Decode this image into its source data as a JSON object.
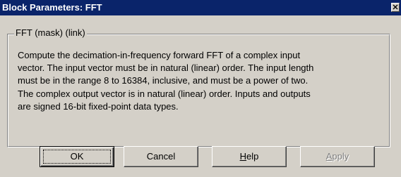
{
  "window": {
    "title": "Block Parameters: FFT"
  },
  "group": {
    "legend": "FFT (mask) (link)",
    "description_lines": [
      "Compute the decimation-in-frequency forward FFT of a complex input",
      "vector. The input vector must be in natural (linear) order. The input length",
      "must be in the range 8 to 16384, inclusive, and must be a power of two.",
      "The complex output vector is in natural (linear) order. Inputs and outputs",
      "are signed 16-bit fixed-point data types."
    ]
  },
  "buttons": {
    "ok": {
      "label": "OK",
      "state": "default"
    },
    "cancel": {
      "label": "Cancel"
    },
    "help": {
      "label_prefix": "",
      "label_mnemonic": "H",
      "label_rest": "elp"
    },
    "apply": {
      "label_prefix": "",
      "label_mnemonic": "A",
      "label_rest": "pply",
      "state": "disabled"
    }
  },
  "colors": {
    "titlebar": "#0a246a",
    "face": "#d4d0c8",
    "disabled_text": "#808080"
  },
  "icons": {
    "close": "close-icon"
  }
}
